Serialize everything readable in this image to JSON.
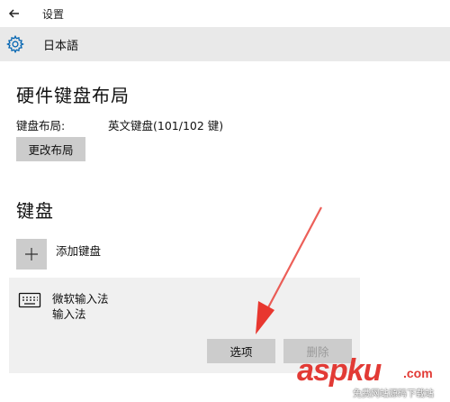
{
  "titlebar": {
    "title": "设置",
    "back_icon": "back-arrow-icon"
  },
  "header": {
    "title": "日本語",
    "icon": "gear-icon"
  },
  "hardware_keyboard": {
    "title": "硬件键盘布局",
    "layout_label": "键盘布局:",
    "layout_value": "英文键盘(101/102 键)",
    "change_button": "更改布局"
  },
  "keyboard": {
    "title": "键盘",
    "add_label": "添加键盘",
    "ime": {
      "name": "微软输入法",
      "subtitle": "输入法",
      "options_button": "选项",
      "delete_button": "删除"
    }
  },
  "watermark": {
    "brand": "aspku",
    "suffix": ".com",
    "tagline": "免费网站源码下载站"
  },
  "colors": {
    "accent": "#0063b1",
    "arrow": "#e8372f",
    "panel": "#f0f0f0",
    "header": "#e9e9e9",
    "button": "#cccccc"
  }
}
